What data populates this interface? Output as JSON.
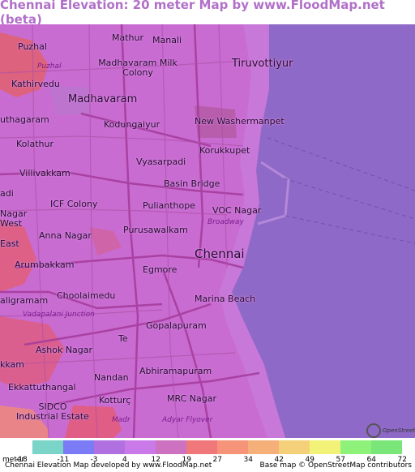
{
  "title": "Chennai Elevation: 20 meter Map by www.FloodMap.net (beta)",
  "map": {
    "places": [
      {
        "name": "Puzhal",
        "style": "normal"
      },
      {
        "name": "Puzhal",
        "style": "italic"
      },
      {
        "name": "Mathur",
        "style": "normal"
      },
      {
        "name": "Manali",
        "style": "normal"
      },
      {
        "name": "Madhavaram Milk Colony",
        "style": "normal"
      },
      {
        "name": "Tiruvottiyur",
        "style": "big"
      },
      {
        "name": "Kathirvedu",
        "style": "normal"
      },
      {
        "name": "Madhavaram",
        "style": "big"
      },
      {
        "name": "uthagaram",
        "style": "normal"
      },
      {
        "name": "Kodungaiyur",
        "style": "normal"
      },
      {
        "name": "New Washermanpet",
        "style": "normal"
      },
      {
        "name": "Kolathur",
        "style": "normal"
      },
      {
        "name": "Korukkupet",
        "style": "normal"
      },
      {
        "name": "Vyasarpadi",
        "style": "normal"
      },
      {
        "name": "Villivakkam",
        "style": "normal"
      },
      {
        "name": "Basin Bridge",
        "style": "normal"
      },
      {
        "name": "adi",
        "style": "normal"
      },
      {
        "name": "ICF Colony",
        "style": "normal"
      },
      {
        "name": "Pulianthope",
        "style": "normal"
      },
      {
        "name": "VOC Nagar",
        "style": "normal"
      },
      {
        "name": "Nagar",
        "style": "normal"
      },
      {
        "name": "Broadway",
        "style": "italic"
      },
      {
        "name": "West",
        "style": "normal"
      },
      {
        "name": "Purusawalkam",
        "style": "normal"
      },
      {
        "name": "Anna Nagar",
        "style": "normal"
      },
      {
        "name": "East",
        "style": "normal"
      },
      {
        "name": "Chennai",
        "style": "huge"
      },
      {
        "name": "Arumbakkam",
        "style": "normal"
      },
      {
        "name": "Egmore",
        "style": "normal"
      },
      {
        "name": "Choolaimedu",
        "style": "normal"
      },
      {
        "name": "aligramam",
        "style": "normal"
      },
      {
        "name": "Marina Beach",
        "style": "normal"
      },
      {
        "name": "Vadapalani Junction",
        "style": "italic"
      },
      {
        "name": "Gopalapuram",
        "style": "normal"
      },
      {
        "name": "Ashok Nagar",
        "style": "normal"
      },
      {
        "name": "Te",
        "style": "normal"
      },
      {
        "name": "kkam",
        "style": "normal"
      },
      {
        "name": "Abhiramapuram",
        "style": "normal"
      },
      {
        "name": "Nandan",
        "style": "normal"
      },
      {
        "name": "Ekkattuthangal",
        "style": "normal"
      },
      {
        "name": "MRC Nagar",
        "style": "normal"
      },
      {
        "name": "Kotturç",
        "style": "normal"
      },
      {
        "name": "SIDCO Industrial Estate",
        "style": "normal"
      },
      {
        "name": "Madr",
        "style": "italic"
      },
      {
        "name": "Adyar Flyover",
        "style": "italic"
      }
    ],
    "osm_logo_text": "OpenStreetMap"
  },
  "legend": {
    "unit": "meter",
    "ticks": [
      "-18",
      "-11",
      "-3",
      "4",
      "12",
      "19",
      "27",
      "34",
      "42",
      "49",
      "57",
      "64",
      "72"
    ],
    "colors": [
      "#7ad4c8",
      "#7b7bf5",
      "#b070e0",
      "#c97ae8",
      "#cc72c0",
      "#f0787a",
      "#f59478",
      "#f5b07a",
      "#f5d07a",
      "#f2f278",
      "#8ef27a",
      "#7ae67a"
    ]
  },
  "footer": {
    "left": "Chennai Elevation Map developed by www.FloodMap.net",
    "right": "Base map © OpenStreetMap contributors"
  },
  "colors": {
    "title": "#b070c8",
    "sea": "#8f69c7",
    "land": "#c56bd3",
    "low_land": "#d67ad6",
    "high_land": "#e05a6e",
    "roads": "#a03a9a"
  }
}
